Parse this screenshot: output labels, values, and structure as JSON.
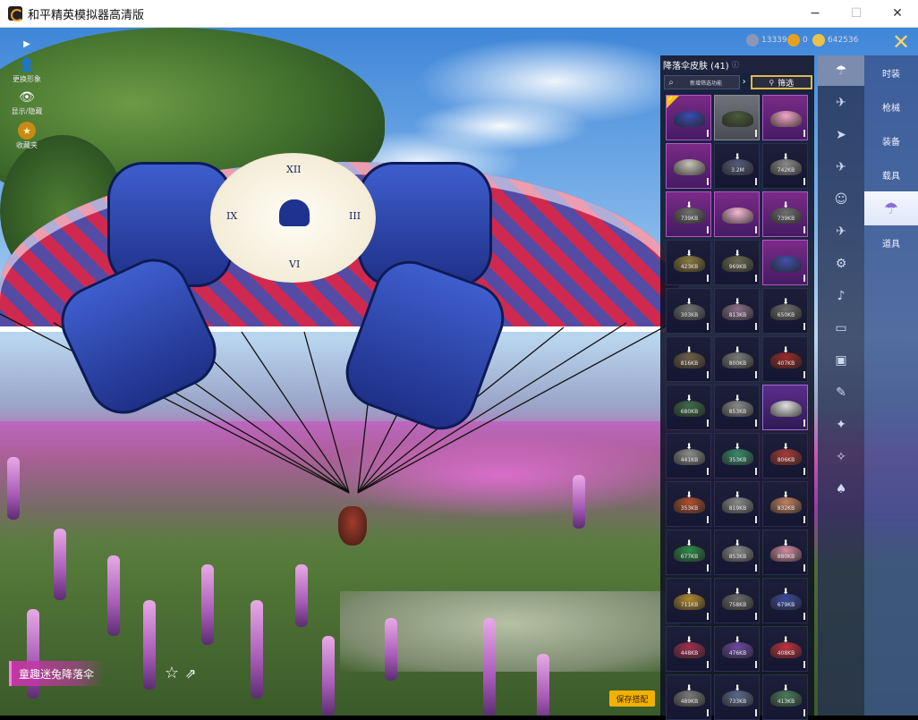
{
  "window": {
    "title": "和平精英模拟器高清版",
    "min_icon": "−",
    "max_icon": "☐",
    "close_icon": "✕"
  },
  "hud_left": {
    "play_icon": "▶",
    "change_appearance": "更换形象",
    "show_hide": "显示/隐藏",
    "collection": "收藏夹"
  },
  "currencies": [
    {
      "name": "coin-silver",
      "value": "13339",
      "color": "#8d97b5"
    },
    {
      "name": "coin-gold",
      "value": "0",
      "color": "#e6a21c"
    },
    {
      "name": "coin-star",
      "value": "642536",
      "color": "#e8c34a"
    }
  ],
  "panel": {
    "title": "降落伞皮肤 (41)",
    "info_icon": "ⓘ",
    "search_placeholder": "新增筛选功能",
    "arrow": "›",
    "filter_label": "筛选",
    "items": [
      {
        "size": "",
        "tier": "purple",
        "selected": true,
        "color": "#3a4bb0"
      },
      {
        "size": "",
        "tier": "gray",
        "selected": false,
        "color": "#4b5a3a"
      },
      {
        "size": "",
        "tier": "purple",
        "selected": false,
        "color": "#f2a6c8"
      },
      {
        "size": "",
        "tier": "purple",
        "selected": false,
        "color": "#c9c3b8"
      },
      {
        "size": "3.2M",
        "tier": "dark",
        "selected": false,
        "color": "#555b78"
      },
      {
        "size": "742KB",
        "tier": "dark",
        "selected": false,
        "color": "#8a8a8a"
      },
      {
        "size": "739KB",
        "tier": "purple",
        "selected": false,
        "color": "#6f6f6f"
      },
      {
        "size": "",
        "tier": "purple",
        "selected": false,
        "color": "#f4b9d4"
      },
      {
        "size": "739KB",
        "tier": "purple",
        "selected": false,
        "color": "#6f6f6f"
      },
      {
        "size": "423KB",
        "tier": "dark",
        "selected": false,
        "color": "#8a7a40"
      },
      {
        "size": "969KB",
        "tier": "dark",
        "selected": false,
        "color": "#6a6a52"
      },
      {
        "size": "",
        "tier": "purple",
        "selected": false,
        "color": "#4250a8"
      },
      {
        "size": "303KB",
        "tier": "dark",
        "selected": false,
        "color": "#6d6f72"
      },
      {
        "size": "813KB",
        "tier": "dark",
        "selected": false,
        "color": "#8a6f8a"
      },
      {
        "size": "650KB",
        "tier": "dark",
        "selected": false,
        "color": "#6b6b6b"
      },
      {
        "size": "816KB",
        "tier": "dark",
        "selected": false,
        "color": "#6e5f4a"
      },
      {
        "size": "800KB",
        "tier": "dark",
        "selected": false,
        "color": "#7a7a7a"
      },
      {
        "size": "407KB",
        "tier": "dark",
        "selected": false,
        "color": "#9a2a2a"
      },
      {
        "size": "680KB",
        "tier": "dark",
        "selected": false,
        "color": "#3f6a4a"
      },
      {
        "size": "853KB",
        "tier": "dark",
        "selected": false,
        "color": "#8a8a8a"
      },
      {
        "size": "",
        "tier": "violet",
        "selected": false,
        "color": "#e0e0e0"
      },
      {
        "size": "441KB",
        "tier": "dark",
        "selected": false,
        "color": "#8c8c8c"
      },
      {
        "size": "353KB",
        "tier": "dark",
        "selected": false,
        "color": "#3a8a6a"
      },
      {
        "size": "806KB",
        "tier": "dark",
        "selected": false,
        "color": "#a83a3a"
      },
      {
        "size": "353KB",
        "tier": "dark",
        "selected": false,
        "color": "#b05030"
      },
      {
        "size": "819KB",
        "tier": "dark",
        "selected": false,
        "color": "#8a8a8a"
      },
      {
        "size": "832KB",
        "tier": "dark",
        "selected": false,
        "color": "#c08060"
      },
      {
        "size": "677KB",
        "tier": "dark",
        "selected": false,
        "color": "#2f8a4a"
      },
      {
        "size": "853KB",
        "tier": "dark",
        "selected": false,
        "color": "#8a8a8a"
      },
      {
        "size": "880KB",
        "tier": "dark",
        "selected": false,
        "color": "#d08aa0"
      },
      {
        "size": "711KB",
        "tier": "dark",
        "selected": false,
        "color": "#b08a30"
      },
      {
        "size": "758KB",
        "tier": "dark",
        "selected": false,
        "color": "#6a6a6a"
      },
      {
        "size": "679KB",
        "tier": "dark",
        "selected": false,
        "color": "#3a4a9a"
      },
      {
        "size": "448KB",
        "tier": "dark",
        "selected": false,
        "color": "#a03050"
      },
      {
        "size": "476KB",
        "tier": "dark",
        "selected": false,
        "color": "#6a4aa0"
      },
      {
        "size": "408KB",
        "tier": "dark",
        "selected": false,
        "color": "#c03040"
      },
      {
        "size": "489KB",
        "tier": "dark",
        "selected": false,
        "color": "#7a7a7a"
      },
      {
        "size": "733KB",
        "tier": "dark",
        "selected": false,
        "color": "#5a6a8a"
      },
      {
        "size": "413KB",
        "tier": "dark",
        "selected": false,
        "color": "#4a7a5a"
      }
    ]
  },
  "categories": [
    {
      "icon": "parachute-icon",
      "glyph": "☂",
      "active": true
    },
    {
      "icon": "plane-icon",
      "glyph": "✈",
      "active": false
    },
    {
      "icon": "jet-icon",
      "glyph": "➤",
      "active": false
    },
    {
      "icon": "glider-icon",
      "glyph": "✈",
      "active": false
    },
    {
      "icon": "emote-icon",
      "glyph": "☺",
      "active": false
    },
    {
      "icon": "vehicle-icon",
      "glyph": "✈",
      "active": false
    },
    {
      "icon": "robot-icon",
      "glyph": "⚙",
      "active": false
    },
    {
      "icon": "speaker-icon",
      "glyph": "♪",
      "active": false
    },
    {
      "icon": "monitor-icon",
      "glyph": "▭",
      "active": false
    },
    {
      "icon": "image-icon",
      "glyph": "▣",
      "active": false
    },
    {
      "icon": "spray-icon",
      "glyph": "✎",
      "active": false
    },
    {
      "icon": "sparkle-icon",
      "glyph": "✦",
      "active": false
    },
    {
      "icon": "magic-icon",
      "glyph": "✧",
      "active": false
    },
    {
      "icon": "hat-icon",
      "glyph": "♠",
      "active": false
    }
  ],
  "tabs": [
    {
      "label": "时装",
      "active": false
    },
    {
      "label": "枪械",
      "active": false
    },
    {
      "label": "装备",
      "active": false
    },
    {
      "label": "载具",
      "active": false
    },
    {
      "label": "",
      "active": true
    },
    {
      "label": "道具",
      "active": false
    }
  ],
  "bottom": {
    "skin_name": "童趣迷兔降落伞",
    "favorite_icon": "☆",
    "share_icon": "⇗",
    "save_label": "保存搭配"
  },
  "close_x": "✕"
}
